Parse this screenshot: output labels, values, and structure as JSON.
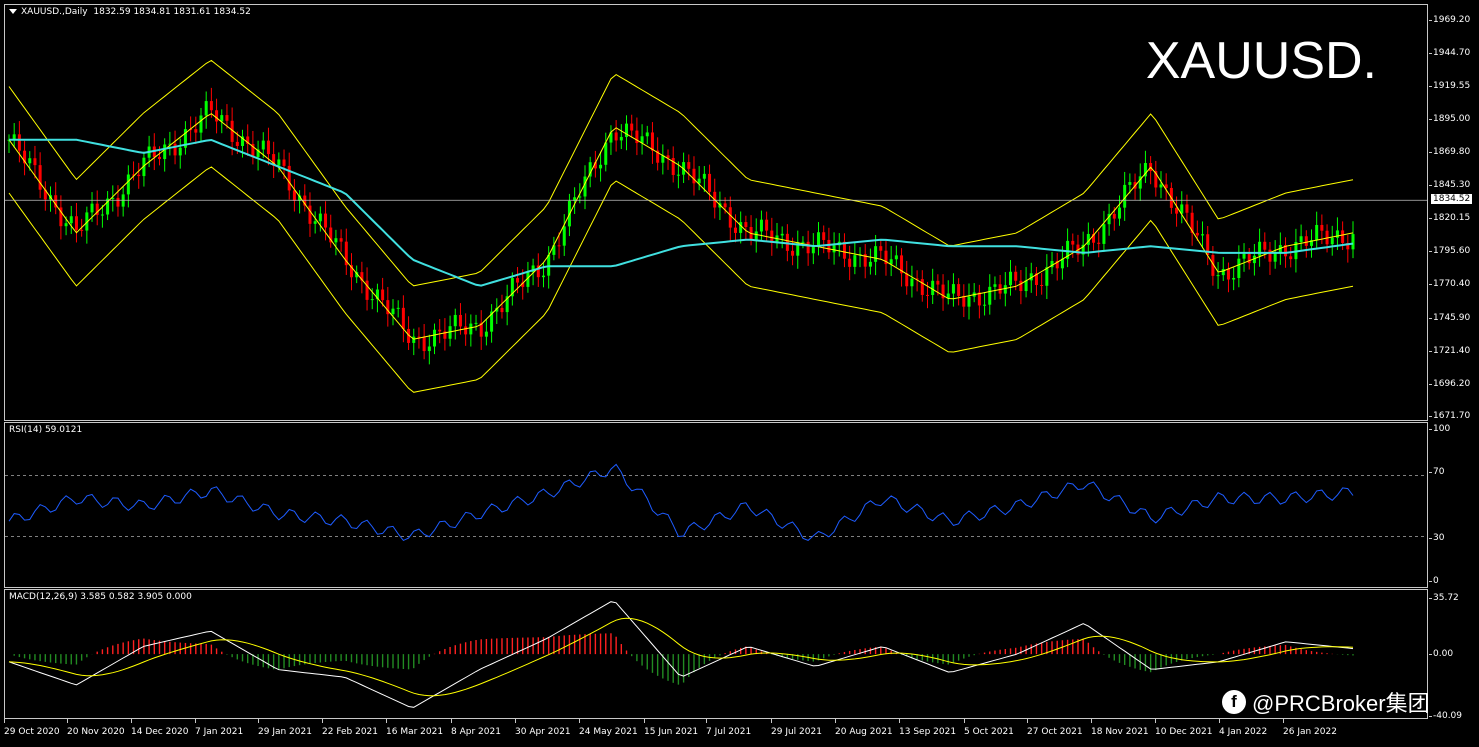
{
  "header": {
    "symbol_label": "XAUUSD.,Daily",
    "ohlc": "1832.59 1834.81 1831.61 1834.52",
    "big_title": "XAUUSD."
  },
  "price_axis": {
    "ticks": [
      "1969.20",
      "1944.70",
      "1919.55",
      "1895.00",
      "1869.80",
      "1845.30",
      "1820.15",
      "1795.60",
      "1770.40",
      "1745.90",
      "1721.40",
      "1696.20",
      "1671.70"
    ],
    "current_price": "1834.52"
  },
  "rsi": {
    "label": "RSI(14) 59.0121",
    "ticks": [
      "100",
      "70",
      "30",
      "0"
    ]
  },
  "macd": {
    "label": "MACD(12,26,9) 3.585 0.582 3.905 0.000",
    "ticks": [
      "35.72",
      "0.00",
      "-40.09"
    ]
  },
  "time_axis": {
    "labels": [
      "29 Oct 2020",
      "20 Nov 2020",
      "14 Dec 2020",
      "7 Jan 2021",
      "29 Jan 2021",
      "22 Feb 2021",
      "16 Mar 2021",
      "8 Apr 2021",
      "30 Apr 2021",
      "24 May 2021",
      "15 Jun 2021",
      "7 Jul 2021",
      "29 Jul 2021",
      "20 Aug 2021",
      "13 Sep 2021",
      "5 Oct 2021",
      "27 Oct 2021",
      "18 Nov 2021",
      "10 Dec 2021",
      "4 Jan 2022",
      "26 Jan 2022"
    ]
  },
  "watermark": {
    "text": "@PRCBroker集团",
    "icon": "facebook-icon"
  },
  "colors": {
    "background": "#000000",
    "bull_candle": "#00ff00",
    "bear_candle": "#ff0000",
    "bollinger": "#ffff00",
    "ma": "#40e0e0",
    "rsi_line": "#1e5cff",
    "macd_hist_pos": "#ff2020",
    "macd_hist_neg": "#228b22",
    "signal": "#ffff00"
  },
  "chart_data": {
    "type": "line",
    "title": "XAUUSD.",
    "x": [
      "29 Oct 2020",
      "20 Nov 2020",
      "14 Dec 2020",
      "7 Jan 2021",
      "29 Jan 2021",
      "22 Feb 2021",
      "16 Mar 2021",
      "8 Apr 2021",
      "30 Apr 2021",
      "24 May 2021",
      "15 Jun 2021",
      "7 Jul 2021",
      "29 Jul 2021",
      "20 Aug 2021",
      "13 Sep 2021",
      "5 Oct 2021",
      "27 Oct 2021",
      "18 Nov 2021",
      "10 Dec 2021",
      "4 Jan 2022",
      "26 Jan 2022"
    ],
    "ylim": [
      1671.7,
      1969.2
    ],
    "series": [
      {
        "values": [
          1880,
          1810,
          1860,
          1900,
          1860,
          1790,
          1730,
          1740,
          1790,
          1890,
          1860,
          1810,
          1800,
          1790,
          1760,
          1770,
          1800,
          1860,
          1780,
          1800,
          1810
        ]
      },
      {
        "values": [
          1880,
          1880,
          1870,
          1880,
          1860,
          1840,
          1790,
          1770,
          1785,
          1785,
          1800,
          1805,
          1800,
          1805,
          1800,
          1800,
          1795,
          1800,
          1795,
          1795,
          1802
        ]
      }
    ],
    "rsi_values": [
      40,
      55,
      50,
      60,
      45,
      40,
      30,
      45,
      58,
      75,
      32,
      50,
      28,
      55,
      40,
      50,
      65,
      42,
      55,
      55,
      59
    ],
    "macd_values": [
      -5,
      -20,
      5,
      15,
      -10,
      -15,
      -35,
      -10,
      10,
      35,
      -15,
      5,
      -8,
      5,
      -12,
      0,
      20,
      -10,
      -5,
      8,
      3.6
    ]
  }
}
